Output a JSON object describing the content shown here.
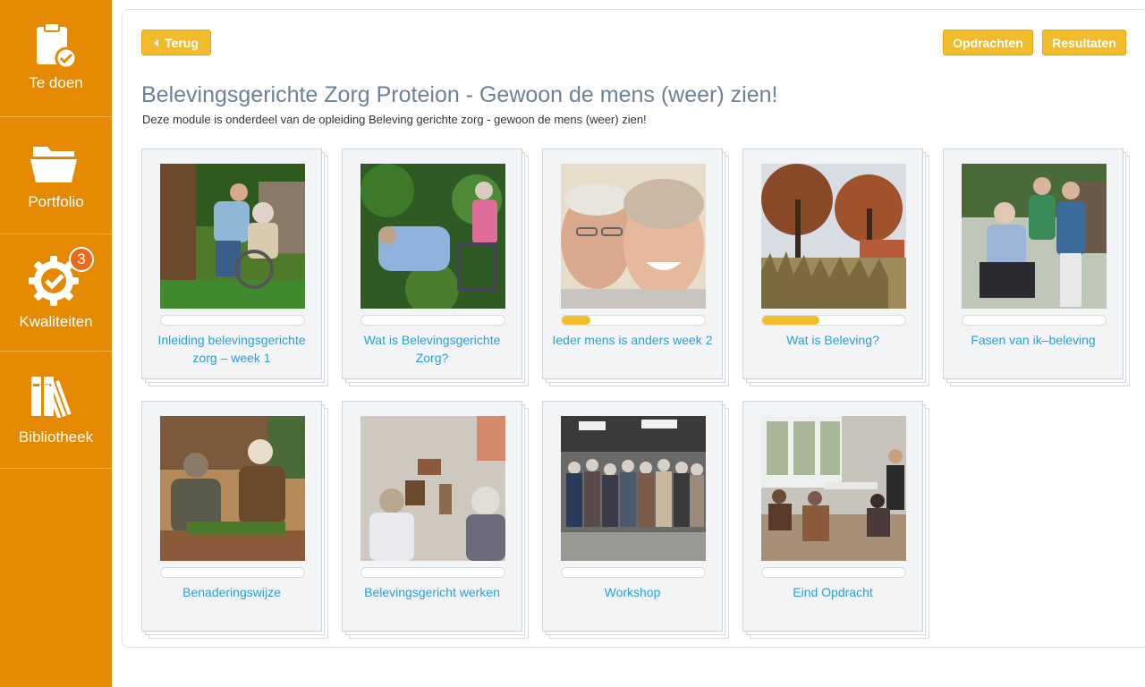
{
  "sidebar": {
    "items": [
      {
        "label": "Te doen",
        "icon": "clipboard-check-icon"
      },
      {
        "label": "Portfolio",
        "icon": "folder-icon"
      },
      {
        "label": "Kwaliteiten",
        "icon": "badge-check-icon",
        "badge": "3"
      },
      {
        "label": "Bibliotheek",
        "icon": "books-icon"
      }
    ],
    "color": "#E58A00"
  },
  "toolbar": {
    "back_label": "Terug",
    "assignments_label": "Opdrachten",
    "results_label": "Resultaten"
  },
  "page": {
    "title": "Belevingsgerichte Zorg Proteion - Gewoon de mens (weer) zien!",
    "subtitle": "Deze module is onderdeel van de opleiding Beleving gerichte zorg - gewoon de mens (weer) zien!"
  },
  "modules": [
    {
      "title": "Inleiding belevingsgerichte zorg – week 1",
      "progress": 0
    },
    {
      "title": "Wat is Belevingsgerichte Zorg?",
      "progress": 0
    },
    {
      "title": "Ieder mens is anders week 2",
      "progress": 0.2
    },
    {
      "title": "Wat is Beleving?",
      "progress": 0.4
    },
    {
      "title": "Fasen van ik–beleving",
      "progress": 0
    },
    {
      "title": "Benaderingswijze",
      "progress": 0
    },
    {
      "title": "Belevingsgericht werken",
      "progress": 0
    },
    {
      "title": "Workshop",
      "progress": 0
    },
    {
      "title": "Eind Opdracht",
      "progress": 0
    }
  ],
  "colors": {
    "accent": "#F2BB2B",
    "link": "#2A9FD6",
    "title": "#6C8198",
    "badge": "#EA6A18"
  }
}
